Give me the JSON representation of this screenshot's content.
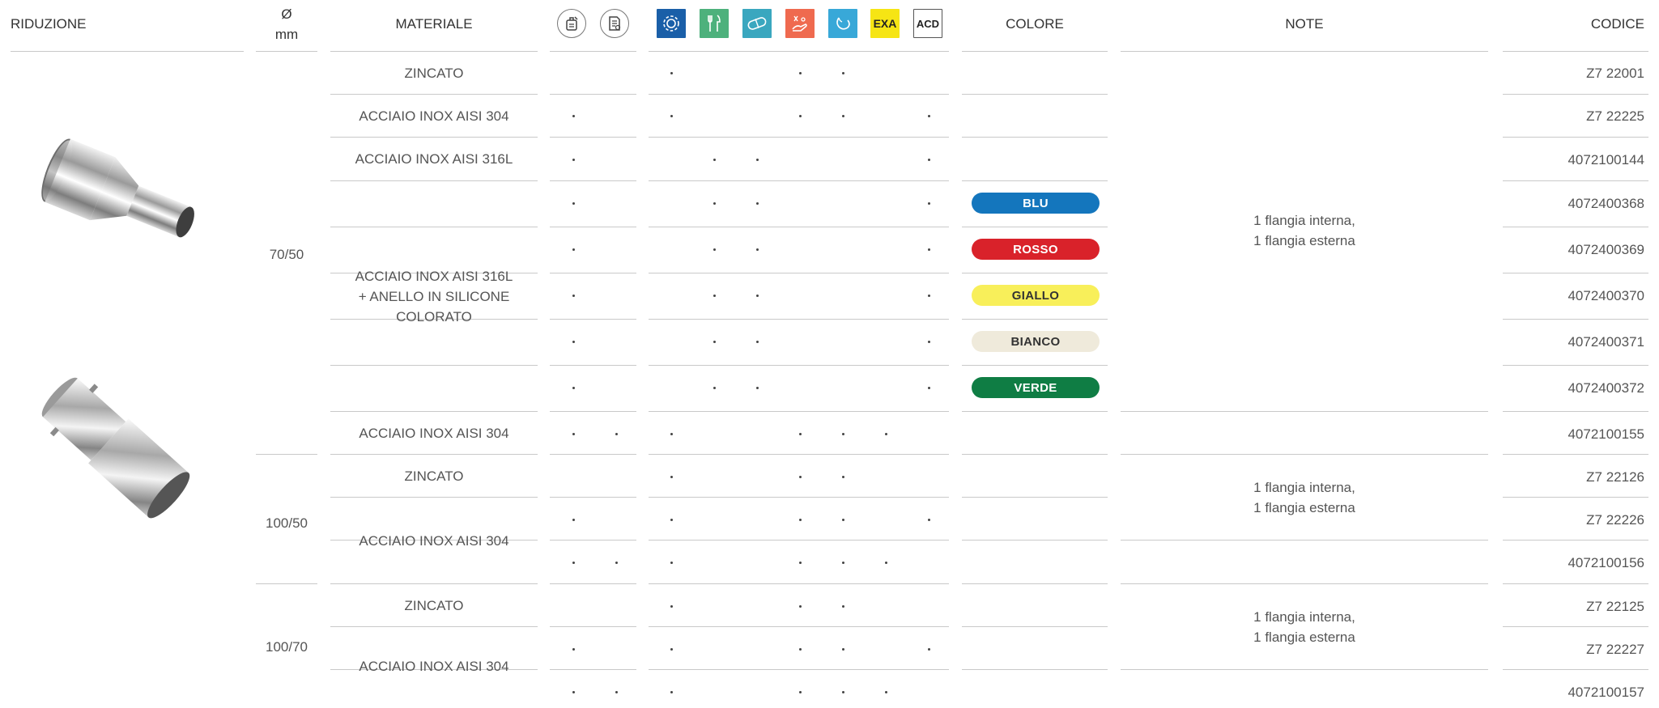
{
  "headers": {
    "riduzione": "RIDUZIONE",
    "diam_symbol": "Ø",
    "diam_unit": "mm",
    "materiale": "MATERIALE",
    "colore": "COLORE",
    "note": "NOTE",
    "codice": "CODICE",
    "exa": "EXA",
    "acd": "ACD"
  },
  "icons": [
    {
      "name": "installation-kit-icon",
      "style": "circle"
    },
    {
      "name": "certification-document-icon",
      "style": "circle"
    },
    {
      "name": "gear-settings-icon",
      "bg": "#1a5fa8"
    },
    {
      "name": "food-cutlery-icon",
      "bg": "#4db17c"
    },
    {
      "name": "pharma-capsule-icon",
      "bg": "#3aa7bf"
    },
    {
      "name": "chemical-hand-icon",
      "bg": "#ef6a4f"
    },
    {
      "name": "water-drop-icon",
      "bg": "#38a8d8"
    },
    {
      "name": "exa-label",
      "bg": "#f6e514"
    },
    {
      "name": "acd-label",
      "bg": "#ffffff"
    }
  ],
  "diameters": [
    "70/50",
    "100/50",
    "100/70"
  ],
  "materials": {
    "zincato_1": "ZINCATO",
    "inox304_1": "ACCIAIO INOX AISI 304",
    "inox316": "ACCIAIO INOX AISI 316L",
    "inox316_colored": [
      "ACCIAIO INOX AISI 316L",
      "+ ANELLO IN SILICONE",
      "COLORATO"
    ],
    "inox304_2": "ACCIAIO INOX AISI 304",
    "zincato_2": "ZINCATO",
    "inox304_3": "ACCIAIO INOX AISI 304",
    "zincato_3": "ZINCATO",
    "inox304_4": "ACCIAIO INOX AISI 304"
  },
  "colors": [
    {
      "label": "BLU",
      "bg": "#1476bd",
      "fg": "#ffffff"
    },
    {
      "label": "ROSSO",
      "bg": "#d9222a",
      "fg": "#ffffff"
    },
    {
      "label": "GIALLO",
      "bg": "#f8ef5a",
      "fg": "#333333"
    },
    {
      "label": "BIANCO",
      "bg": "#efeadb",
      "fg": "#333333"
    },
    {
      "label": "VERDE",
      "bg": "#0f7d44",
      "fg": "#ffffff"
    }
  ],
  "notes": [
    [
      "1 flangia interna,",
      "1 flangia esterna"
    ],
    [
      "1 flangia interna,",
      "1 flangia esterna"
    ],
    [
      "1 flangia interna,",
      "1 flangia esterna"
    ]
  ],
  "rows": [
    {
      "codice": "Z7 22001",
      "marks": [
        0,
        0,
        1,
        0,
        0,
        1,
        1,
        0,
        0
      ]
    },
    {
      "codice": "Z7 22225",
      "marks": [
        1,
        0,
        1,
        0,
        0,
        1,
        1,
        0,
        1
      ]
    },
    {
      "codice": "4072100144",
      "marks": [
        1,
        0,
        0,
        1,
        1,
        0,
        0,
        0,
        1
      ]
    },
    {
      "codice": "4072400368",
      "marks": [
        1,
        0,
        0,
        1,
        1,
        0,
        0,
        0,
        1
      ]
    },
    {
      "codice": "4072400369",
      "marks": [
        1,
        0,
        0,
        1,
        1,
        0,
        0,
        0,
        1
      ]
    },
    {
      "codice": "4072400370",
      "marks": [
        1,
        0,
        0,
        1,
        1,
        0,
        0,
        0,
        1
      ]
    },
    {
      "codice": "4072400371",
      "marks": [
        1,
        0,
        0,
        1,
        1,
        0,
        0,
        0,
        1
      ]
    },
    {
      "codice": "4072400372",
      "marks": [
        1,
        0,
        0,
        1,
        1,
        0,
        0,
        0,
        1
      ]
    },
    {
      "codice": "4072100155",
      "marks": [
        1,
        1,
        1,
        0,
        0,
        1,
        1,
        1,
        0
      ]
    },
    {
      "codice": "Z7 22126",
      "marks": [
        0,
        0,
        1,
        0,
        0,
        1,
        1,
        0,
        0
      ]
    },
    {
      "codice": "Z7 22226",
      "marks": [
        1,
        0,
        1,
        0,
        0,
        1,
        1,
        0,
        1
      ]
    },
    {
      "codice": "4072100156",
      "marks": [
        1,
        1,
        1,
        0,
        0,
        1,
        1,
        1,
        0
      ]
    },
    {
      "codice": "Z7 22125",
      "marks": [
        0,
        0,
        1,
        0,
        0,
        1,
        1,
        0,
        0
      ]
    },
    {
      "codice": "Z7 22227",
      "marks": [
        1,
        0,
        1,
        0,
        0,
        1,
        1,
        0,
        1
      ]
    },
    {
      "codice": "4072100157",
      "marks": [
        1,
        1,
        1,
        0,
        0,
        1,
        1,
        1,
        0
      ]
    }
  ]
}
